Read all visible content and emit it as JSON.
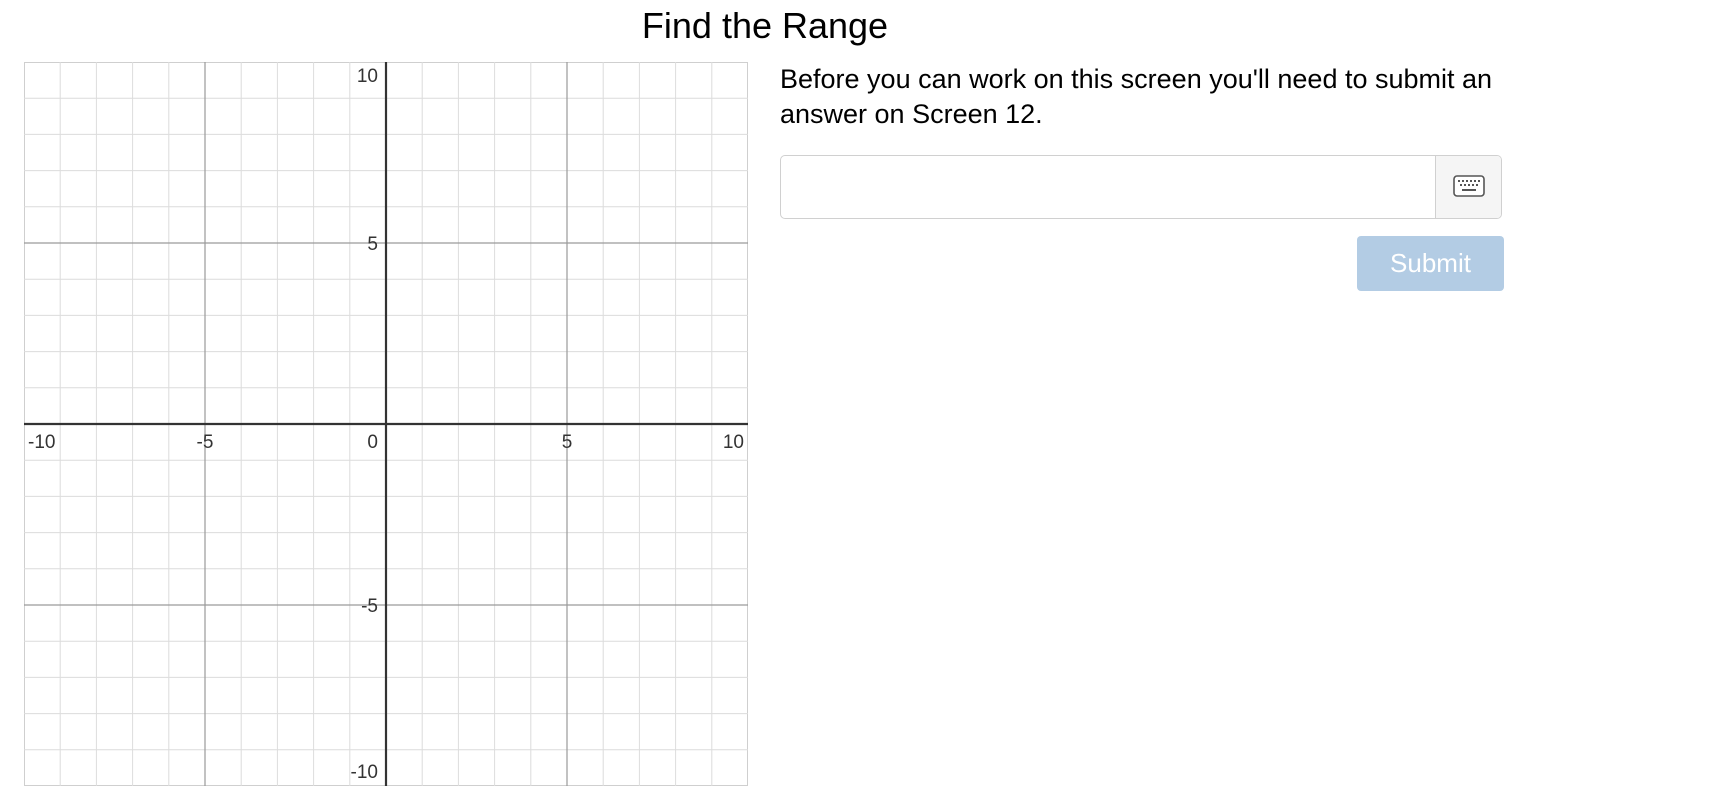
{
  "page": {
    "title": "Find the Range"
  },
  "graph": {
    "x_range": [
      -10,
      10
    ],
    "y_range": [
      -10,
      10
    ],
    "minor_step": 1,
    "major_step": 5,
    "grid": true,
    "x_tick_labels": [
      "-10",
      "-5",
      "0",
      "5",
      "10"
    ],
    "y_tick_labels": [
      "10",
      "5",
      "-5",
      "-10"
    ]
  },
  "prompt": {
    "text": "Before you can work on this screen you'll need to submit an answer on Screen 12."
  },
  "answer": {
    "value": "",
    "placeholder": "",
    "keypad_icon": "keyboard-icon"
  },
  "submit": {
    "label": "Submit",
    "enabled": false
  },
  "colors": {
    "minor_grid": "#dcdcdc",
    "major_grid": "#9a9a9a",
    "axis": "#333333",
    "submit_disabled_bg": "#b3cce4"
  }
}
